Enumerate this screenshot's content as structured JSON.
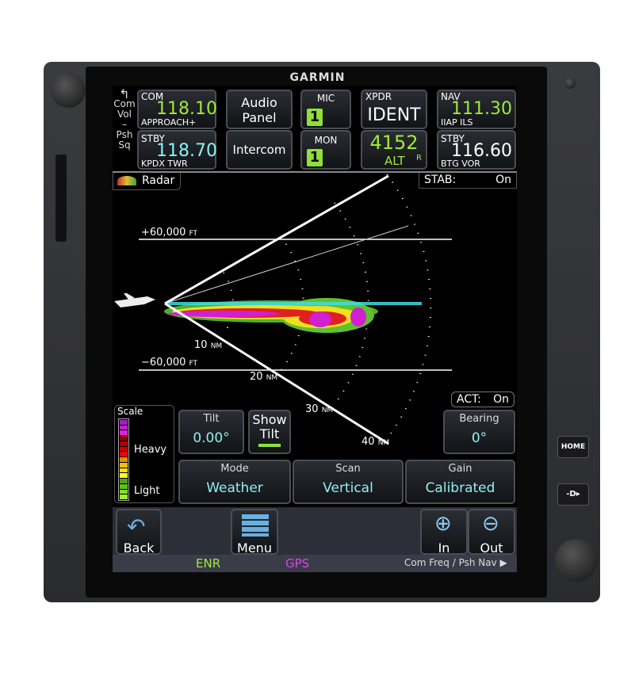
{
  "brand": "GARMIN",
  "com": {
    "label": "COM",
    "active": "118.10",
    "active_name": "APPROACH+",
    "stby_label": "STBY",
    "stby": "118.70",
    "stby_name": "KPDX TWR",
    "side": [
      "Com",
      "Vol",
      "–",
      "Psh",
      "Sq"
    ]
  },
  "audio": {
    "label1": "Audio",
    "label2": "Panel",
    "intercom": "Intercom"
  },
  "mic": {
    "label": "MIC",
    "value": "1"
  },
  "mon": {
    "label": "MON",
    "value": "1"
  },
  "xpdr": {
    "label": "XPDR",
    "ident": "IDENT",
    "code": "4152",
    "mode": "ALT",
    "reply": "R"
  },
  "nav": {
    "label": "NAV",
    "active": "111.30",
    "active_name": "IIAP ILS",
    "stby_label": "STBY",
    "stby": "116.60",
    "stby_name": "BTG VOR"
  },
  "page": {
    "title": "Radar",
    "stab_label": "STAB:",
    "stab_value": "On",
    "act_label": "ACT:",
    "act_value": "On"
  },
  "radar": {
    "alt_upper": "+60,000",
    "alt_lower": "−60,000",
    "alt_unit": "FT",
    "ranges": [
      {
        "v": "10",
        "u": "NM"
      },
      {
        "v": "20",
        "u": "NM"
      },
      {
        "v": "30",
        "u": "NM"
      },
      {
        "v": "40",
        "u": "NM"
      }
    ]
  },
  "scale": {
    "label": "Scale",
    "heavy": "Heavy",
    "light": "Light",
    "colors": [
      "#a020c0",
      "#c020d0",
      "#e020e0",
      "#900000",
      "#b00000",
      "#d00000",
      "#ff0000",
      "#e09000",
      "#f0c000",
      "#ffe000",
      "#ffff30",
      "#50a020",
      "#60c020",
      "#80e020",
      "#a0f030"
    ]
  },
  "controls": {
    "tilt_label": "Tilt",
    "tilt_value": "0.00°",
    "show_tilt": [
      "Show",
      "Tilt"
    ],
    "bearing_label": "Bearing",
    "bearing_value": "0°",
    "mode_label": "Mode",
    "mode_value": "Weather",
    "scan_label": "Scan",
    "scan_value": "Vertical",
    "gain_label": "Gain",
    "gain_value": "Calibrated"
  },
  "bottom": {
    "back": "Back",
    "menu": "Menu",
    "in": "In",
    "out": "Out"
  },
  "status": {
    "phase": "ENR",
    "source": "GPS",
    "hint": "Com Freq / Psh Nav ▶"
  },
  "buttons": {
    "home": "HOME",
    "direct": "-D▸"
  },
  "colors": {
    "green": "#9eea3a",
    "cyan": "#8ff0f0",
    "magenta": "#e040f0"
  }
}
